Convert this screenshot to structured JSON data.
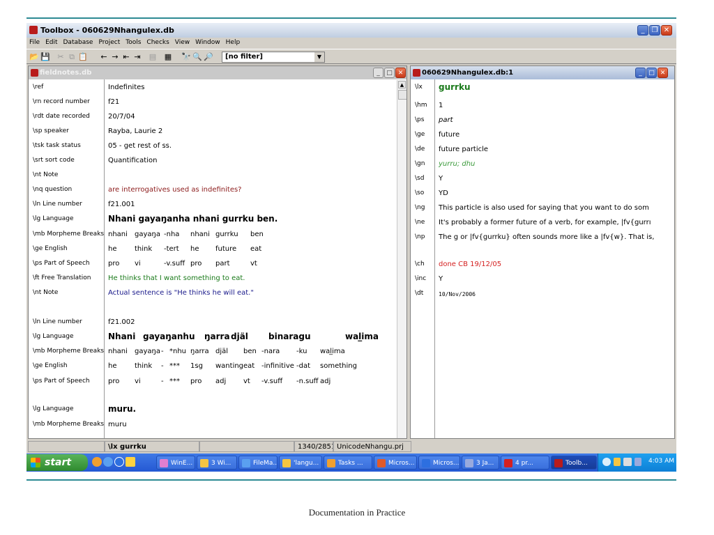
{
  "window": {
    "title": "Toolbox - 060629Nhangulex.db"
  },
  "menu": [
    "File",
    "Edit",
    "Database",
    "Project",
    "Tools",
    "Checks",
    "View",
    "Window",
    "Help"
  ],
  "toolbar": {
    "filter_value": "[no filter]"
  },
  "left_pane": {
    "title": "fieldnotes.db",
    "fields": [
      {
        "marker": "\\ref",
        "value": "Indefinites"
      },
      {
        "marker": "\\rn record number",
        "value": "f21"
      },
      {
        "marker": "\\rdt date recorded",
        "value": "20/7/04"
      },
      {
        "marker": "\\sp speaker",
        "value": "Rayba, Laurie 2"
      },
      {
        "marker": "\\tsk task status",
        "value": "05 - get rest of ss."
      },
      {
        "marker": "\\srt sort code",
        "value": "Quantification"
      },
      {
        "marker": "\\nt Note",
        "value": ""
      },
      {
        "marker": "\\nq question",
        "value": "are interrogatives used as indefinites?"
      },
      {
        "marker": "\\ln Line number",
        "value": "f21.001"
      },
      {
        "marker": "\\lg Language",
        "value": "Nhani gayaŋanha   nhani gurrku ben."
      },
      {
        "marker": "\\mb Morpheme Breaks",
        "value": ""
      },
      {
        "marker": "\\ge English",
        "value": ""
      },
      {
        "marker": "\\ps Part of Speech",
        "value": ""
      },
      {
        "marker": "\\ft Free Translation",
        "value": "He thinks that I want something to eat."
      },
      {
        "marker": "\\nt Note",
        "value": "Actual sentence is \"He thinks he will eat.\""
      },
      {
        "marker": "\\ln Line number",
        "value": "f21.002"
      },
      {
        "marker": "\\lg Language",
        "value": ""
      },
      {
        "marker": "\\mb Morpheme Breaks",
        "value": ""
      },
      {
        "marker": "\\ge English",
        "value": ""
      },
      {
        "marker": "\\ps Part of Speech",
        "value": ""
      },
      {
        "marker": "\\lg Language",
        "value": "muru."
      },
      {
        "marker": "\\mb Morpheme Breaks",
        "value": "muru"
      }
    ],
    "gloss1": {
      "mb": [
        "nhani",
        "gayaŋa",
        "-nha",
        "nhani",
        "gurrku",
        "ben"
      ],
      "ge": [
        "he",
        "think",
        "-tert",
        "he",
        "future",
        "eat"
      ],
      "ps": [
        "pro",
        "vi",
        "-v.suff",
        "pro",
        "part",
        "vt"
      ]
    },
    "gloss2": {
      "lg": [
        "Nhani",
        "gayaŋanhu",
        "ŋarra",
        "djäl",
        "binaragu",
        "wal̲ima"
      ],
      "mb": [
        "nhani",
        "gayaŋa",
        "-",
        "*nhu",
        "ŋarra",
        "djäl",
        "ben",
        "-nara",
        "-ku",
        "wal̲ima"
      ],
      "ge": [
        "he",
        "think",
        "-",
        "***",
        "1sg",
        "wanting",
        "eat",
        "-infinitive",
        "-dat",
        "something"
      ],
      "ps": [
        "pro",
        "vi",
        "-",
        "***",
        "pro",
        "adj",
        "vt",
        "-v.suff",
        "-n.suff",
        "adj"
      ]
    }
  },
  "right_pane": {
    "title": "060629Nhangulex.db:1",
    "fields": [
      {
        "marker": "\\lx",
        "value": "gurrku"
      },
      {
        "marker": "\\hm",
        "value": "1"
      },
      {
        "marker": "\\ps",
        "value": "part"
      },
      {
        "marker": "\\ge",
        "value": "future"
      },
      {
        "marker": "\\de",
        "value": "future particle"
      },
      {
        "marker": "\\gn",
        "value": "yurru; dhu"
      },
      {
        "marker": "\\sd",
        "value": "Y"
      },
      {
        "marker": "\\so",
        "value": "YD"
      },
      {
        "marker": "\\ng",
        "value": "This particle is also used for saying that you want to do som"
      },
      {
        "marker": "\\ne",
        "value": "It's probably a former future of a verb, for example, |fv{gurrı"
      },
      {
        "marker": "\\np",
        "value": "The g or |fv{gurrku} often sounds more like a |fv{w}. That is,"
      },
      {
        "marker": "\\ch",
        "value": "done CB 19/12/05"
      },
      {
        "marker": "\\inc",
        "value": "Y"
      },
      {
        "marker": "\\dt",
        "value": "10/Nov/2006"
      }
    ]
  },
  "status": {
    "field": "\\lx gurrku",
    "position": "1340/2851",
    "project": "UnicodeNhangu.prj"
  },
  "taskbar": {
    "start": "start",
    "items": [
      "WinE...",
      "3 Wi...",
      "FileMa...",
      "'langu...",
      "Tasks ...",
      "Micros...",
      "Micros...",
      "3 Ja...",
      "4 pr...",
      "Toolb..."
    ],
    "clock": "4:03 AM"
  },
  "caption": "Documentation in Practice"
}
